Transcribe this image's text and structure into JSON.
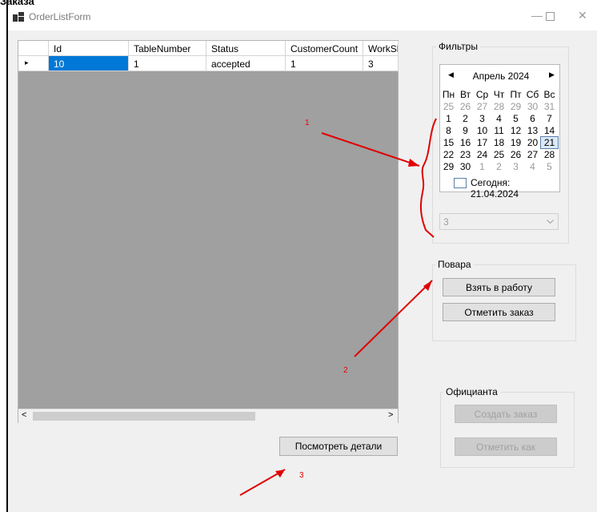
{
  "window": {
    "title": "OrderListForm"
  },
  "page_header_cut": "Заказа",
  "grid": {
    "columns": [
      "Id",
      "TableNumber",
      "Status",
      "CustomerCount",
      "WorkSh"
    ],
    "rows": [
      [
        "10",
        "1",
        "accepted",
        "1",
        "3"
      ]
    ],
    "row_indicator": "▸"
  },
  "filters": {
    "title": "Фильтры",
    "calendar": {
      "month": "Апрель 2024",
      "weekdays": [
        "Пн",
        "Вт",
        "Ср",
        "Чт",
        "Пт",
        "Сб",
        "Вс"
      ],
      "weeks": [
        [
          "25",
          "26",
          "27",
          "28",
          "29",
          "30",
          "31"
        ],
        [
          "1",
          "2",
          "3",
          "4",
          "5",
          "6",
          "7"
        ],
        [
          "8",
          "9",
          "10",
          "11",
          "12",
          "13",
          "14"
        ],
        [
          "15",
          "16",
          "17",
          "18",
          "19",
          "20",
          "21"
        ],
        [
          "22",
          "23",
          "24",
          "25",
          "26",
          "27",
          "28"
        ],
        [
          "29",
          "30",
          "1",
          "2",
          "3",
          "4",
          "5"
        ]
      ],
      "selected_day": "21",
      "today_label": "Сегодня: 21.04.2024"
    },
    "combo_value": "3"
  },
  "cooks": {
    "title": "Повара",
    "take_button": "Взять в работу",
    "mark_button": "Отметить заказ"
  },
  "waiters": {
    "title": "Официанта",
    "create_button": "Создать заказ",
    "mark_button": "Отметить как"
  },
  "details_button": "Посмотреть детали",
  "annotations": [
    "1",
    "2",
    "3"
  ],
  "colors": {
    "selection": "#0078d7",
    "annotation": "#e00000",
    "grid_bg": "#a0a0a0"
  }
}
